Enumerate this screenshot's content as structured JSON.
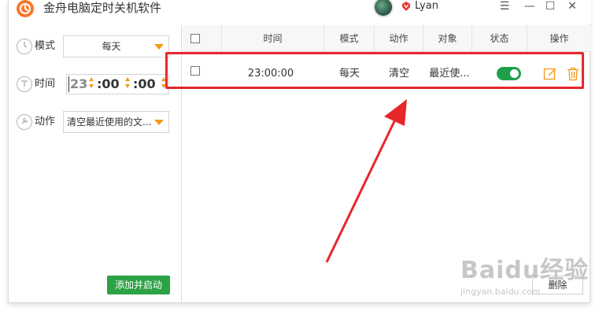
{
  "window": {
    "title": "金舟电脑定时关机软件",
    "username": "Lyan",
    "controls": {
      "menu": "☰",
      "minimize": "—",
      "maximize": "☐",
      "close": "✕"
    }
  },
  "left": {
    "mode_label": "模式",
    "mode_value": "每天",
    "time_label": "时间",
    "time_hours": "23",
    "time_minutes": ":00",
    "time_seconds": ":00",
    "action_label": "动作",
    "action_value": "清空最近使用的文...",
    "add_button": "添加并启动"
  },
  "table": {
    "headers": [
      "时间",
      "模式",
      "动作",
      "对象",
      "状态",
      "操作"
    ],
    "rows": [
      {
        "time": "23:00:00",
        "mode": "每天",
        "action": "清空",
        "target": "最近使...",
        "status_on": true
      }
    ]
  },
  "delete_button": "删除",
  "watermark": {
    "brand": "Baidu经验",
    "url": "jingyan.baidu.com"
  },
  "colors": {
    "accent": "#f29a1a",
    "green": "#2ba244",
    "highlight": "#e8272c",
    "logo": "#f5792a"
  },
  "icons": [
    "alarm-clock-icon",
    "clock-icon",
    "wrench-icon",
    "edit-icon",
    "trash-icon",
    "vip-crown-icon"
  ]
}
